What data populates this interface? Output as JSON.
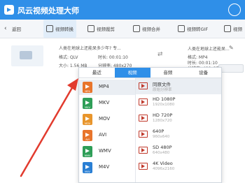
{
  "app": {
    "title": "风云视频处理大师"
  },
  "toolbar": {
    "back_label": "返回",
    "tabs": [
      {
        "label": "视频转换"
      },
      {
        "label": "视频裁剪"
      },
      {
        "label": "视频合并"
      },
      {
        "label": "视频转GIF"
      },
      {
        "label": "视频"
      }
    ]
  },
  "file": {
    "name_left": "人类在地球上还能呆多少年? 专...",
    "format_left": "格式: QLV",
    "duration_left": "时长: 00:01:10",
    "size_left": "大小: 1.56 MB",
    "resolution_left": "分辨率: 480x270",
    "name_right": "人类在地球上还能呆...",
    "format_right": "格式: MP4",
    "duration_right": "时长: 00:01:10",
    "resolution_right": "分辨率: 480x270"
  },
  "popup": {
    "tabs": [
      "最近",
      "视频",
      "音频",
      "设备"
    ],
    "active_tab": "视频",
    "formats": [
      {
        "label": "MP4",
        "color": "#e8752c"
      },
      {
        "label": "MKV",
        "color": "#2e9e57"
      },
      {
        "label": "MOV",
        "color": "#e8952c"
      },
      {
        "label": "AVI",
        "color": "#e8752c"
      },
      {
        "label": "WMV",
        "color": "#2e9e57"
      },
      {
        "label": "M4V",
        "color": "#2a7fd4"
      }
    ],
    "selected_format": "MP4",
    "qualities": [
      {
        "name": "同原文件",
        "res": "原始分辨率"
      },
      {
        "name": "HD 1080P",
        "res": "1920x1080"
      },
      {
        "name": "HD 720P",
        "res": "1280x720"
      },
      {
        "name": "640P",
        "res": "960x640"
      },
      {
        "name": "SD 480P",
        "res": "640x480"
      },
      {
        "name": "4K Video",
        "res": "4096x2160"
      }
    ]
  },
  "colors": {
    "titlebar": "#2f8fe8",
    "accent": "#2f8fe8",
    "annotation": "#e23b2e"
  }
}
